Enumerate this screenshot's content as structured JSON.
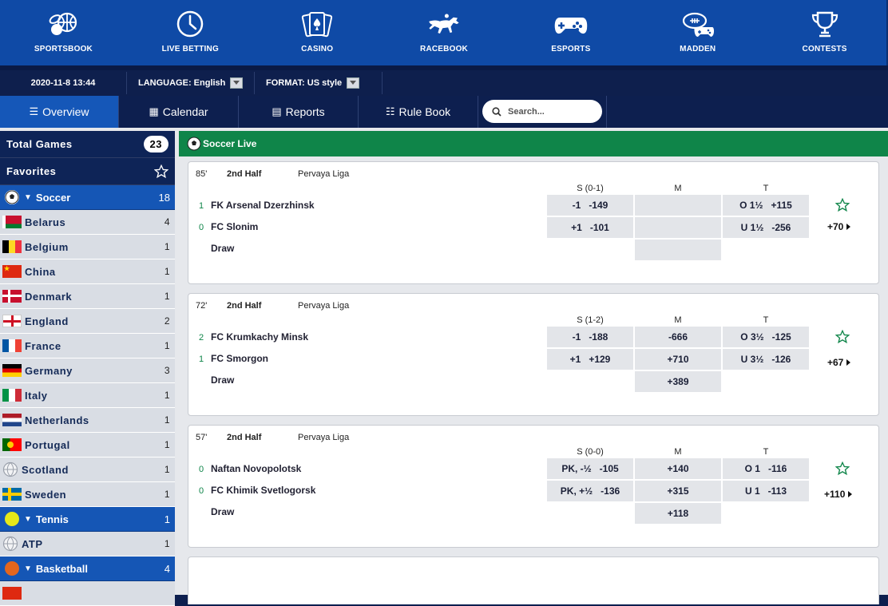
{
  "topnav": [
    {
      "label": "SPORTSBOOK",
      "icon": "sportsbook-icon"
    },
    {
      "label": "LIVE BETTING",
      "icon": "clock-icon"
    },
    {
      "label": "CASINO",
      "icon": "cards-icon"
    },
    {
      "label": "RACEBOOK",
      "icon": "horse-icon"
    },
    {
      "label": "ESPORTS",
      "icon": "gamepad-icon"
    },
    {
      "label": "MADDEN",
      "icon": "madden-icon"
    },
    {
      "label": "CONTESTS",
      "icon": "trophy-icon"
    }
  ],
  "infobar": {
    "datetime": "2020-11-8 13:44",
    "language_label": "LANGUAGE:",
    "language_value": "English",
    "format_label": "FORMAT:",
    "format_value": "US style"
  },
  "tabs": [
    {
      "label": "Overview",
      "icon": "list-icon",
      "active": true
    },
    {
      "label": "Calendar",
      "icon": "calendar-icon"
    },
    {
      "label": "Reports",
      "icon": "report-icon"
    },
    {
      "label": "Rule Book",
      "icon": "book-icon"
    }
  ],
  "search": {
    "placeholder": "Search..."
  },
  "sidebar": {
    "total_label": "Total Games",
    "total_count": "23",
    "favorites_label": "Favorites",
    "soccer": {
      "label": "Soccer",
      "count": "18"
    },
    "soccer_items": [
      {
        "label": "Belarus",
        "count": "4"
      },
      {
        "label": "Belgium",
        "count": "1"
      },
      {
        "label": "China",
        "count": "1"
      },
      {
        "label": "Denmark",
        "count": "1"
      },
      {
        "label": "England",
        "count": "2"
      },
      {
        "label": "France",
        "count": "1"
      },
      {
        "label": "Germany",
        "count": "3"
      },
      {
        "label": "Italy",
        "count": "1"
      },
      {
        "label": "Netherlands",
        "count": "1"
      },
      {
        "label": "Portugal",
        "count": "1"
      },
      {
        "label": "Scotland",
        "count": "1"
      },
      {
        "label": "Sweden",
        "count": "1"
      }
    ],
    "tennis": {
      "label": "Tennis",
      "count": "1"
    },
    "tennis_items": [
      {
        "label": "ATP",
        "count": "1"
      }
    ],
    "basketball": {
      "label": "Basketball",
      "count": "4"
    }
  },
  "section_title": "Soccer Live",
  "games": [
    {
      "minute": "85'",
      "half": "2nd Half",
      "league": "Pervaya Liga",
      "spread_header": "S (0-1)",
      "money_header": "M",
      "total_header": "T",
      "teams": [
        {
          "score": "1",
          "name": "FK Arsenal Dzerzhinsk",
          "spread_a": "-1",
          "spread_b": "-149",
          "money": "",
          "total_a": "O 1½",
          "total_b": "+115"
        },
        {
          "score": "0",
          "name": "FC Slonim",
          "spread_a": "+1",
          "spread_b": "-101",
          "money": "",
          "total_a": "U 1½",
          "total_b": "-256"
        }
      ],
      "draw_label": "Draw",
      "draw_money": "",
      "more": "+70"
    },
    {
      "minute": "72'",
      "half": "2nd Half",
      "league": "Pervaya Liga",
      "spread_header": "S (1-2)",
      "money_header": "M",
      "total_header": "T",
      "teams": [
        {
          "score": "2",
          "name": "FC Krumkachy Minsk",
          "spread_a": "-1",
          "spread_b": "-188",
          "money": "-666",
          "total_a": "O 3½",
          "total_b": "-125"
        },
        {
          "score": "1",
          "name": "FC Smorgon",
          "spread_a": "+1",
          "spread_b": "+129",
          "money": "+710",
          "total_a": "U 3½",
          "total_b": "-126"
        }
      ],
      "draw_label": "Draw",
      "draw_money": "+389",
      "more": "+67"
    },
    {
      "minute": "57'",
      "half": "2nd Half",
      "league": "Pervaya Liga",
      "spread_header": "S (0-0)",
      "money_header": "M",
      "total_header": "T",
      "teams": [
        {
          "score": "0",
          "name": "Naftan Novopolotsk",
          "spread_a": "PK, -½",
          "spread_b": "-105",
          "money": "+140",
          "total_a": "O 1",
          "total_b": "-116"
        },
        {
          "score": "0",
          "name": "FC Khimik Svetlogorsk",
          "spread_a": "PK, +½",
          "spread_b": "-136",
          "money": "+315",
          "total_a": "U 1",
          "total_b": "-113"
        }
      ],
      "draw_label": "Draw",
      "draw_money": "+118",
      "more": "+110"
    }
  ],
  "colors": {
    "brand_blue": "#0f4aa6",
    "dark_navy": "#0d1f4f",
    "live_green": "#0f8549",
    "sport_blue": "#1556b5"
  }
}
